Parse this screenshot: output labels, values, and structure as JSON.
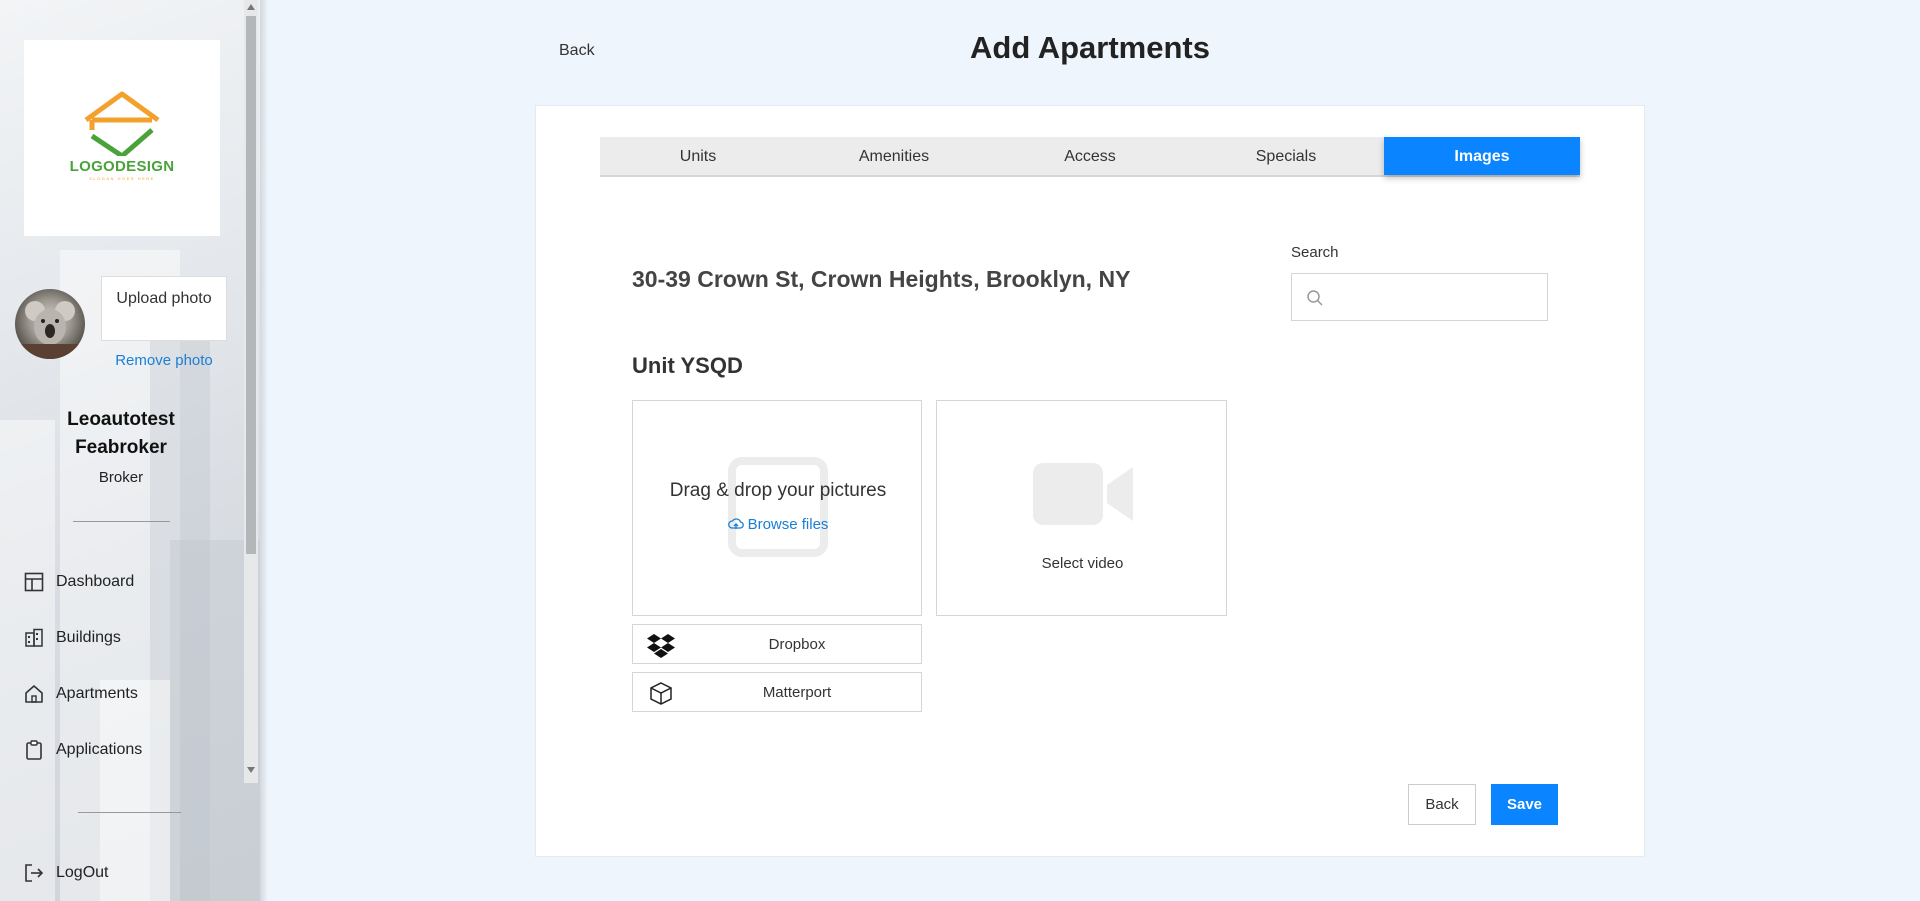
{
  "page": {
    "title": "Add Apartments",
    "back_label": "Back"
  },
  "sidebar": {
    "logo_text": "LOGODESIGN",
    "logo_tagline": "SLOGAN GOES HERE",
    "upload_photo_label": "Upload photo",
    "remove_photo_label": "Remove photo",
    "user_name": "Leoautotest Feabroker",
    "user_role": "Broker",
    "nav": [
      {
        "label": "Dashboard",
        "icon": "dashboard-icon"
      },
      {
        "label": "Buildings",
        "icon": "buildings-icon"
      },
      {
        "label": "Apartments",
        "icon": "home-icon"
      },
      {
        "label": "Applications",
        "icon": "clipboard-icon"
      }
    ],
    "logout_label": "LogOut"
  },
  "tabs": [
    {
      "label": "Units",
      "active": false
    },
    {
      "label": "Amenities",
      "active": false
    },
    {
      "label": "Access",
      "active": false
    },
    {
      "label": "Specials",
      "active": false
    },
    {
      "label": "Images",
      "active": true
    }
  ],
  "content": {
    "address": "30-39 Crown St, Crown Heights, Brooklyn, NY",
    "search": {
      "label": "Search",
      "placeholder": "",
      "value": ""
    },
    "unit_title": "Unit YSQD",
    "drop_text": "Drag & drop your pictures",
    "browse_label": "Browse files",
    "video_label": "Select video",
    "dropbox_label": "Dropbox",
    "matterport_label": "Matterport"
  },
  "actions": {
    "back_label": "Back",
    "save_label": "Save"
  },
  "colors": {
    "accent": "#0a84ff",
    "link": "#1a7fd4",
    "logo_green": "#4aa33a",
    "logo_orange": "#f2a22c"
  }
}
